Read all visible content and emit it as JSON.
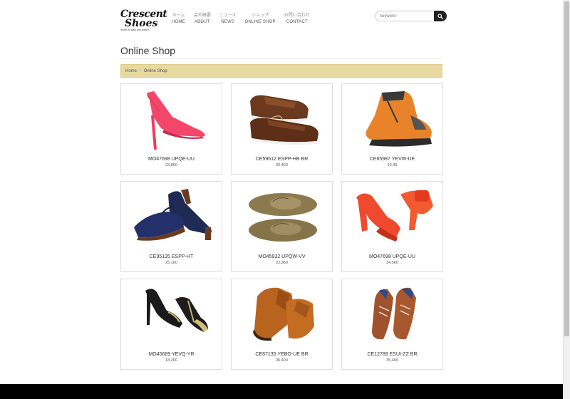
{
  "logo": {
    "line1": "Crescent",
    "line2": "Shoes",
    "tagline": "Shoes to walk and dream"
  },
  "nav": [
    {
      "jp": "ホーム",
      "en": "HOME"
    },
    {
      "jp": "会社概要",
      "en": "ABOUT"
    },
    {
      "jp": "ニュース",
      "en": "NEWS"
    },
    {
      "jp": "ショップ",
      "en": "ONLINE SHOP"
    },
    {
      "jp": "お問い合わせ",
      "en": "CONTACT"
    }
  ],
  "search": {
    "placeholder": "keyword",
    "icon": "search-icon"
  },
  "page_title": "Online Shop",
  "breadcrumb": {
    "home": "Home",
    "separator": "/",
    "current": "Online Shop"
  },
  "products": [
    {
      "name": "MO47698 UPQE-UU",
      "price": "23,860",
      "icon": "pink-slingback-heel"
    },
    {
      "name": "CE59612 ESPP-HB BR",
      "price": "26,460",
      "icon": "brown-boat-shoes"
    },
    {
      "name": "CE65987 YEVW-UE",
      "price": "19,46",
      "icon": "orange-hiking-boot"
    },
    {
      "name": "CE95135 ESPP-HT",
      "price": "25,160",
      "icon": "navy-mary-jane-pumps"
    },
    {
      "name": "MO45932 UPQW-VV",
      "price": "22,360",
      "icon": "suede-moccasins"
    },
    {
      "name": "MO47698 UPQE-UU",
      "price": "34,560",
      "icon": "red-platform-heel"
    },
    {
      "name": "MO45689 YEVQ-YR",
      "price": "18,260",
      "icon": "black-gold-pumps"
    },
    {
      "name": "CE87135 YEBO-UE BR",
      "price": "35,400",
      "icon": "tan-oxford-shoes"
    },
    {
      "name": "CE12789 ESUI-ZZ BR",
      "price": "35,400",
      "icon": "woven-brown-oxfords"
    }
  ],
  "colors": {
    "breadcrumb_bg": "#e8d9a0",
    "link": "#2a6496",
    "footer": "#000000"
  }
}
